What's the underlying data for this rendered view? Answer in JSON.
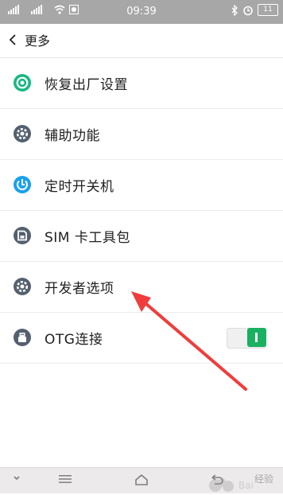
{
  "status_bar": {
    "time": "09:39",
    "battery": "11"
  },
  "header": {
    "title": "更多"
  },
  "items": [
    {
      "label": "恢复出厂设置",
      "icon": "restore-icon"
    },
    {
      "label": "辅助功能",
      "icon": "gear-icon"
    },
    {
      "label": "定时开关机",
      "icon": "timer-power-icon"
    },
    {
      "label": "SIM 卡工具包",
      "icon": "sim-card-icon"
    },
    {
      "label": "开发者选项",
      "icon": "gear-icon"
    },
    {
      "label": "OTG连接",
      "icon": "usb-otg-icon",
      "toggle_on": true
    }
  ],
  "watermark": {
    "text": "经验"
  },
  "colors": {
    "status_bar": "#a7a7a7",
    "accent_green": "#19b061",
    "icon_gray": "#55606f",
    "icon_blue": "#1aa0ef",
    "icon_green": "#17b981",
    "annotation_arrow": "#f03c3c"
  }
}
